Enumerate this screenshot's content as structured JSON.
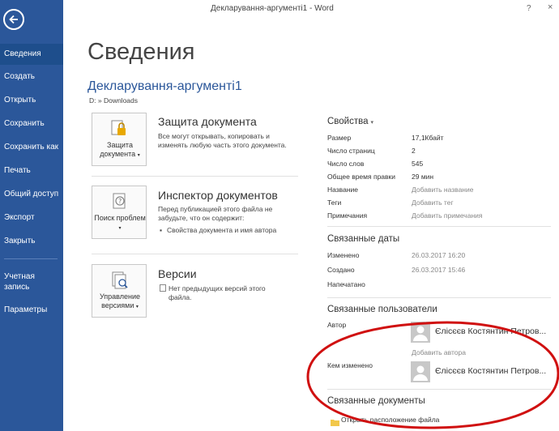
{
  "window": {
    "title": "Декларування-аргументі1 - Word",
    "help": "?",
    "close": "×"
  },
  "sidebar": {
    "items": [
      "Сведения",
      "Создать",
      "Открыть",
      "Сохранить",
      "Сохранить как",
      "Печать",
      "Общий доступ",
      "Экспорт",
      "Закрыть"
    ],
    "account": "Учетная запись",
    "options": "Параметры",
    "active": "Сведения"
  },
  "page": {
    "title": "Сведения",
    "doc_name": "Декларування-аргументі1",
    "doc_path": "D: » Downloads"
  },
  "blocks": {
    "protect": {
      "button": "Защита документа",
      "title": "Защита документа",
      "desc": "Все могут открывать, копировать и изменять любую часть этого документа."
    },
    "inspect": {
      "button": "Поиск проблем",
      "title": "Инспектор документов",
      "desc": "Перед публикацией этого файла не забудьте, что он содержит:",
      "bullet": "Свойства документа и имя автора"
    },
    "versions": {
      "button": "Управление версиями",
      "title": "Версии",
      "bullet": "Нет предыдущих версий этого файла."
    }
  },
  "properties": {
    "title": "Свойства",
    "rows": [
      {
        "label": "Размер",
        "value": "17,1Кбайт"
      },
      {
        "label": "Число страниц",
        "value": "2"
      },
      {
        "label": "Число слов",
        "value": "545"
      },
      {
        "label": "Общее время правки",
        "value": "29 мин"
      },
      {
        "label": "Название",
        "value": "Добавить название"
      },
      {
        "label": "Теги",
        "value": "Добавить тег"
      },
      {
        "label": "Примечания",
        "value": "Добавить примечания"
      }
    ]
  },
  "dates": {
    "title": "Связанные даты",
    "rows": [
      {
        "label": "Изменено",
        "value": "26.03.2017 16:20"
      },
      {
        "label": "Создано",
        "value": "26.03.2017 15:46"
      },
      {
        "label": "Напечатано",
        "value": ""
      }
    ]
  },
  "people": {
    "title": "Связанные пользователи",
    "author_label": "Автор",
    "author_name": "Єлісєєв Костянтин Петров...",
    "add_author": "Добавить автора",
    "modified_label": "Кем изменено",
    "modified_name": "Єлісєєв Костянтин Петров..."
  },
  "related_docs": {
    "title": "Связанные документы",
    "open_location": "Открыть расположение файла"
  },
  "colors": {
    "sidebar": "#2b579a",
    "accent": "#2b579a",
    "annotation": "#d01010"
  }
}
